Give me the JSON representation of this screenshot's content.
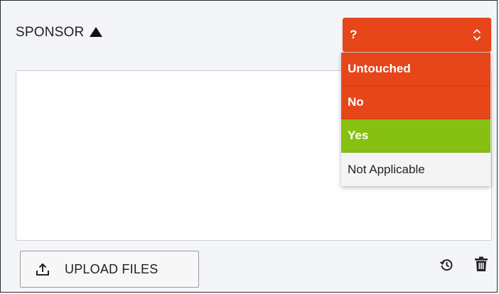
{
  "section": {
    "title": "SPONSOR",
    "sort_icon": "triangle-up-icon"
  },
  "status_select": {
    "value": "?",
    "color": "#e6461a",
    "arrows_icon": "chevron-up-down-icon"
  },
  "dropdown": {
    "options": [
      {
        "label": "Untouched",
        "color": "#e6461a"
      },
      {
        "label": "No",
        "color": "#e6461a"
      },
      {
        "label": "Yes",
        "color": "#86c112"
      },
      {
        "label": "Not Applicable",
        "color": "#f4f4f4"
      }
    ]
  },
  "comment_box": {
    "value": ""
  },
  "actions": {
    "upload_label": "UPLOAD FILES",
    "upload_icon": "upload-icon",
    "history_icon": "history-icon",
    "delete_icon": "trash-icon"
  }
}
